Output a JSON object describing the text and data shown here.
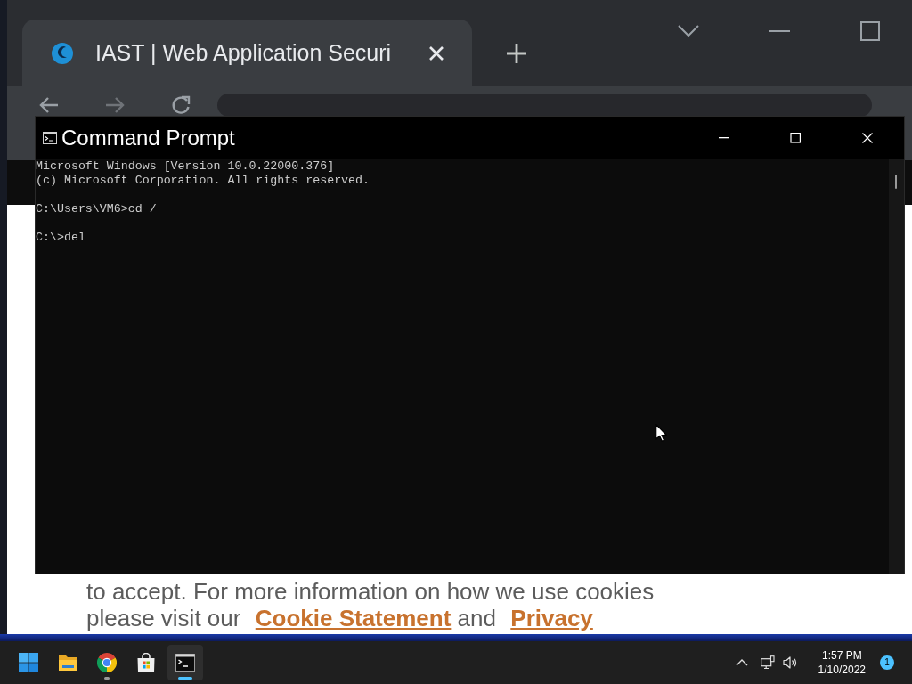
{
  "browser": {
    "tabs": [
      {
        "title": "IAST | Web Application Securi",
        "selected": true
      }
    ],
    "page": {
      "cookie_notice": [
        {
          "kind": "text",
          "text": "to accept. For more information on how we use cookies"
        },
        {
          "kind": "break"
        },
        {
          "kind": "text",
          "text": "please visit our"
        },
        {
          "kind": "link",
          "text": "Cookie Statement"
        },
        {
          "kind": "text",
          "text": "and"
        },
        {
          "kind": "link",
          "text": "Privacy"
        }
      ]
    }
  },
  "console_window": {
    "title": "Command Prompt",
    "output_blocks": [
      [
        "Microsoft Windows [Version 10.0.22000.376]",
        "(c) Microsoft Corporation. All rights reserved."
      ],
      [
        "C:\\Users\\VM6>cd /"
      ],
      [
        "C:\\>del"
      ]
    ]
  },
  "taskbar": {
    "apps": [
      {
        "kind": "start",
        "running": false,
        "selected": false
      },
      {
        "kind": "folder",
        "running": false,
        "selected": false
      },
      {
        "kind": "browser",
        "running": true,
        "selected": false
      },
      {
        "kind": "store",
        "running": false,
        "selected": false
      },
      {
        "kind": "terminal",
        "running": true,
        "selected": true
      }
    ],
    "tray": {
      "time": "1:57 PM",
      "date": "1/10/2022",
      "notification_count": "1"
    }
  }
}
